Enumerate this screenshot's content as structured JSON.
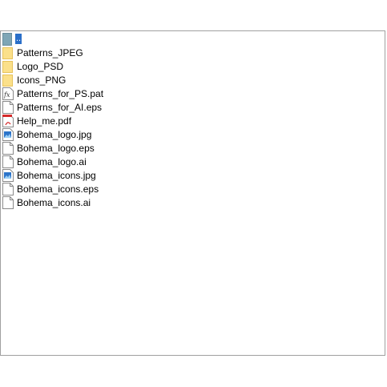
{
  "items": [
    {
      "label": "..",
      "icon": "parent-folder-icon",
      "type": "up",
      "selected": true
    },
    {
      "label": "Patterns_JPEG",
      "icon": "folder-icon",
      "type": "folder"
    },
    {
      "label": "Logo_PSD",
      "icon": "folder-icon",
      "type": "folder"
    },
    {
      "label": "Icons_PNG",
      "icon": "folder-icon",
      "type": "folder"
    },
    {
      "label": "Patterns_for_PS.pat",
      "icon": "fx-file-icon",
      "type": "fx"
    },
    {
      "label": "Patterns_for_AI.eps",
      "icon": "blank-file-icon",
      "type": "blank"
    },
    {
      "label": "Help_me.pdf",
      "icon": "pdf-file-icon",
      "type": "pdf"
    },
    {
      "label": "Bohema_logo.jpg",
      "icon": "image-file-icon",
      "type": "image"
    },
    {
      "label": "Bohema_logo.eps",
      "icon": "blank-file-icon",
      "type": "blank"
    },
    {
      "label": "Bohema_logo.ai",
      "icon": "blank-file-icon",
      "type": "blank"
    },
    {
      "label": "Bohema_icons.jpg",
      "icon": "image-file-icon",
      "type": "image"
    },
    {
      "label": "Bohema_icons.eps",
      "icon": "blank-file-icon",
      "type": "blank"
    },
    {
      "label": "Bohema_icons.ai",
      "icon": "blank-file-icon",
      "type": "blank"
    }
  ],
  "colors": {
    "selection": "#2a6fc9",
    "folder": "#fbe08a",
    "folder_border": "#e7c35c",
    "pdf_red": "#d42a2a",
    "image_blue": "#2c74c9",
    "border": "#a0a0a0"
  }
}
